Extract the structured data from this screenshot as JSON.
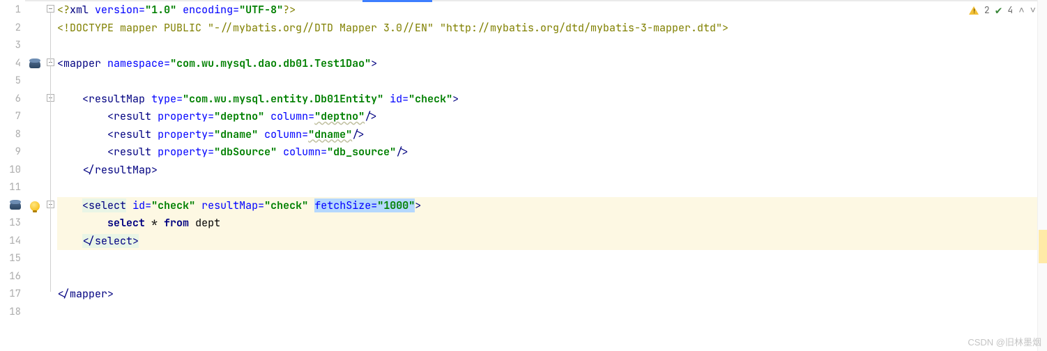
{
  "status": {
    "warnings": "2",
    "oks": "4"
  },
  "watermark": "CSDN @旧林墨烟",
  "gutter": [
    "1",
    "2",
    "3",
    "4",
    "5",
    "6",
    "7",
    "8",
    "9",
    "10",
    "11",
    "12",
    "13",
    "14",
    "15",
    "16",
    "17",
    "18"
  ],
  "xml": {
    "decl_version_attr": "version",
    "decl_version_val": "\"1.0\"",
    "decl_encoding_attr": "encoding",
    "decl_encoding_val": "\"UTF-8\"",
    "doctype": "<!DOCTYPE mapper PUBLIC \"-//mybatis.org//DTD Mapper 3.0//EN\" \"http://mybatis.org/dtd/mybatis-3-mapper.dtd\">",
    "mapper_tag": "mapper",
    "namespace_attr": "namespace",
    "namespace_val": "\"com.wu.mysql.dao.db01.Test1Dao\"",
    "resultMap_tag": "resultMap",
    "type_attr": "type",
    "type_val": "\"com.wu.mysql.entity.Db01Entity\"",
    "id_attr": "id",
    "check_val": "\"check\"",
    "result_tag": "result",
    "property_attr": "property",
    "column_attr": "column",
    "deptno_val": "\"deptno\"",
    "dname_val": "\"dname\"",
    "dbSource_val": "\"dbSource\"",
    "db_source_val": "\"db_source\"",
    "select_tag": "select",
    "resultMap_attr": "resultMap",
    "fetchSize_attr": "fetchSize",
    "fetchSize_val": "\"1000\"",
    "sql_select": "select",
    "sql_star": " * ",
    "sql_from": "from",
    "sql_table": " dept"
  }
}
